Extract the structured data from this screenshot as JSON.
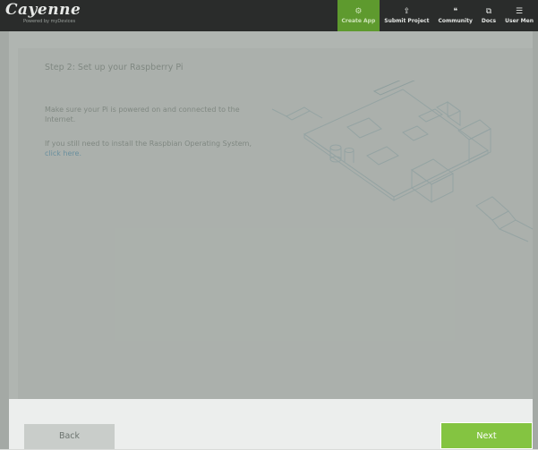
{
  "brand": {
    "title": "Cayenne",
    "subtitle": "Powered by myDevices"
  },
  "nav": {
    "items": [
      {
        "label": "Create App",
        "icon": "⚙",
        "active": true
      },
      {
        "label": "Submit Project",
        "icon": "⇪"
      },
      {
        "label": "Community",
        "icon": "❝"
      },
      {
        "label": "Docs",
        "icon": "⧉"
      },
      {
        "label": "User Men",
        "icon": "☰"
      }
    ]
  },
  "step": {
    "title": "Step 2: Set up your Raspberry Pi",
    "instruction_1": "Make sure your Pi is powered on and connected to the Internet.",
    "instruction_2_prefix": "If you still need to install the Raspbian Operating System,",
    "instruction_2_link": "click here."
  },
  "footer": {
    "back_label": "Back",
    "next_label": "Next"
  },
  "colors": {
    "topbar": "#2a2c2b",
    "accent_active": "#5e9a2e",
    "next_button": "#84c441",
    "link": "#5aa3c9"
  }
}
